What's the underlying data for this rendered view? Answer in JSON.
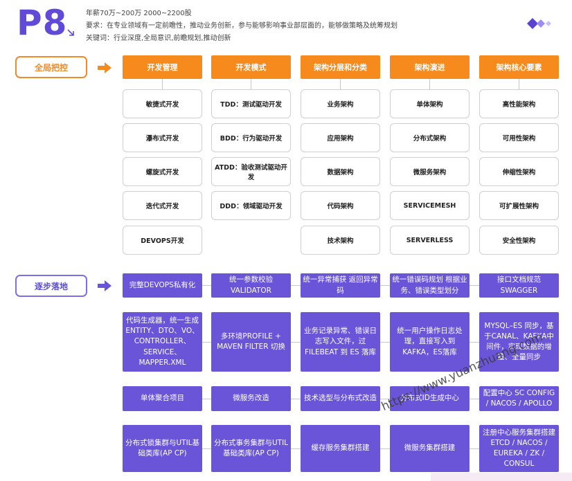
{
  "header": {
    "title": "P8",
    "salary": "年薪70万~200万 2000~2200股",
    "requirement": "要求：在专业领域有一定前瞻性，推动业务创新，参与能够影响事业部层面的，能够做策略及统筹规划",
    "keywords": "关键词：行业深度,全局意识,前瞻规划,推动创新"
  },
  "sections": {
    "global": "全局把控",
    "landing": "逐步落地"
  },
  "columns": [
    {
      "header": "开发管理",
      "items": [
        "敏捷式开发",
        "瀑布式开发",
        "螺旋式开发",
        "迭代式开发",
        "DEVOPS开发"
      ]
    },
    {
      "header": "开发模式",
      "items": [
        "TDD：测试驱动开发",
        "BDD：行为驱动开发",
        "ATDD：验收测试驱动开发",
        "DDD：领域驱动开发"
      ]
    },
    {
      "header": "架构分层和分类",
      "items": [
        "业务架构",
        "应用架构",
        "数据架构",
        "代码架构",
        "技术架构"
      ]
    },
    {
      "header": "架构演进",
      "items": [
        "单体架构",
        "分布式架构",
        "微服务架构",
        "SERVICEMESH",
        "SERVERLESS"
      ]
    },
    {
      "header": "架构核心要素",
      "items": [
        "高性能架构",
        "可用性架构",
        "伸缩性架构",
        "可扩展性架构",
        "安全性架构"
      ]
    }
  ],
  "landing_rows": [
    [
      "完整DEVOPS私有化",
      "统一参数校验 VALIDATOR",
      "统一异常捕获 返回异常码",
      "统一错误码规划 根据业务、错误类型划分",
      "接口文档规范 SWAGGER"
    ],
    [
      "代码生成器，统一生成ENTITY、DTO、VO、CONTROLLER、SERVICE、MAPPER.XML",
      "多环境PROFILE + MAVEN FILTER 切换",
      "业务记录异常、错误日志写入文件，过FILEBEAT 到 ES 落库",
      "统一用户操作日志处理，直接写入到KAFKA，ES落库",
      "MYSQL–ES 同步，基于CANAL、KAFKA中间件，实现数据的增量、全量同步"
    ],
    [
      "单体聚合项目",
      "微服务改造",
      "技术选型与分布式改造",
      "分布式ID生成中心",
      "配置中心 SC CONFIG / NACOS / APOLLO"
    ],
    [
      "分布式锁集群与UTIL基础类库(AP CP)",
      "分布式事务集群与UTIL基础类库(AP CP)",
      "缓存服务集群搭建",
      "微服务集群搭建",
      "注册中心服务集群搭建 ETCD / NACOS / EUREKA / ZK / CONSUL"
    ]
  ],
  "watermark": "https://www.yuanzhuang.com",
  "colors": {
    "orange": "#f68a1c",
    "purple": "#6a55d8",
    "title": "#5f4bd8"
  }
}
